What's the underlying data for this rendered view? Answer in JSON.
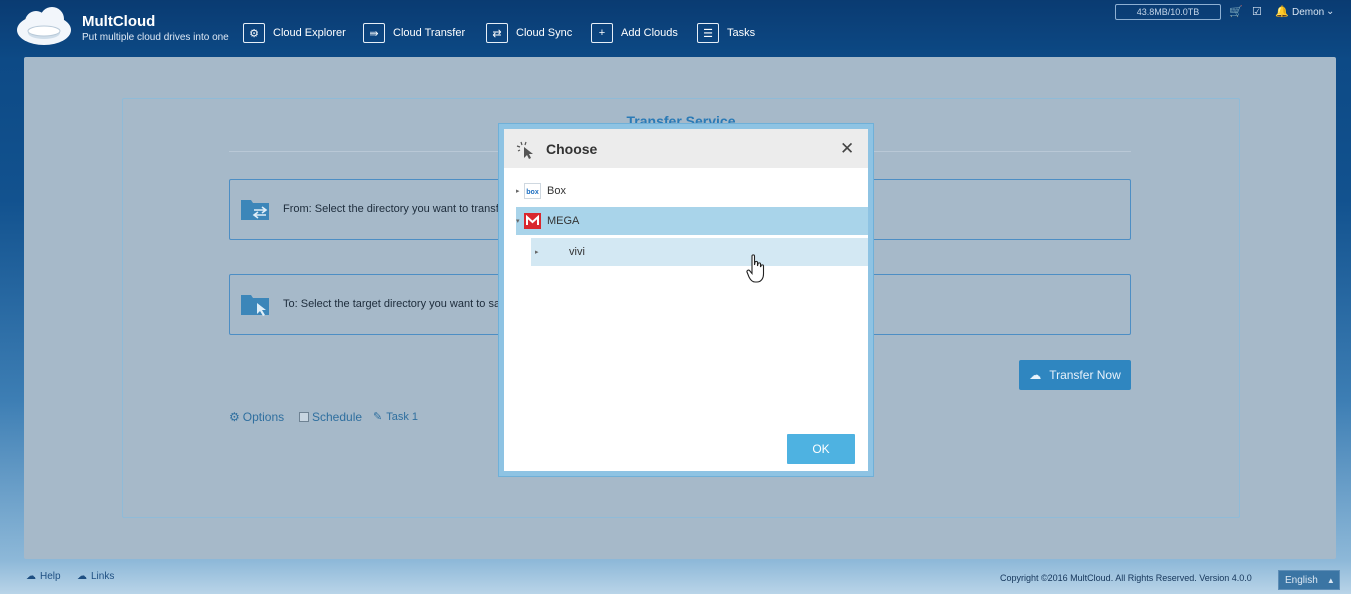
{
  "header": {
    "logo_title": "MultCloud",
    "logo_subtitle": "Put multiple cloud drives into one",
    "nav": [
      {
        "label": "Cloud Explorer",
        "icon": "gear-icon"
      },
      {
        "label": "Cloud Transfer",
        "icon": "transfer-icon"
      },
      {
        "label": "Cloud Sync",
        "icon": "sync-icon"
      },
      {
        "label": "Add Clouds",
        "icon": "plus-icon"
      },
      {
        "label": "Tasks",
        "icon": "tasks-icon"
      }
    ],
    "storage": "43.8MB/10.0TB",
    "user": "Demon"
  },
  "main": {
    "title": "Transfer Service",
    "from_text": "From: Select the directory you want to transfer",
    "to_text": "To: Select the target directory you want to sav",
    "options_label": "Options",
    "schedule_label": "Schedule",
    "task_label": "Task 1",
    "transfer_now_label": "Transfer Now"
  },
  "dialog": {
    "title": "Choose",
    "tree": [
      {
        "label": "Box",
        "icon": "box-icon"
      },
      {
        "label": "MEGA",
        "icon": "mega-icon"
      },
      {
        "label": "vivi",
        "icon": "folder-icon"
      }
    ],
    "ok_label": "OK"
  },
  "footer": {
    "help_label": "Help",
    "links_label": "Links",
    "copyright": "Copyright ©2016 MultCloud. All Rights Reserved. Version 4.0.0",
    "language": "English"
  },
  "colors": {
    "accent": "#2f86c0",
    "dialog_button": "#4eb2e1",
    "selected_row": "#a9d4ea",
    "mega_red": "#d9272e"
  }
}
